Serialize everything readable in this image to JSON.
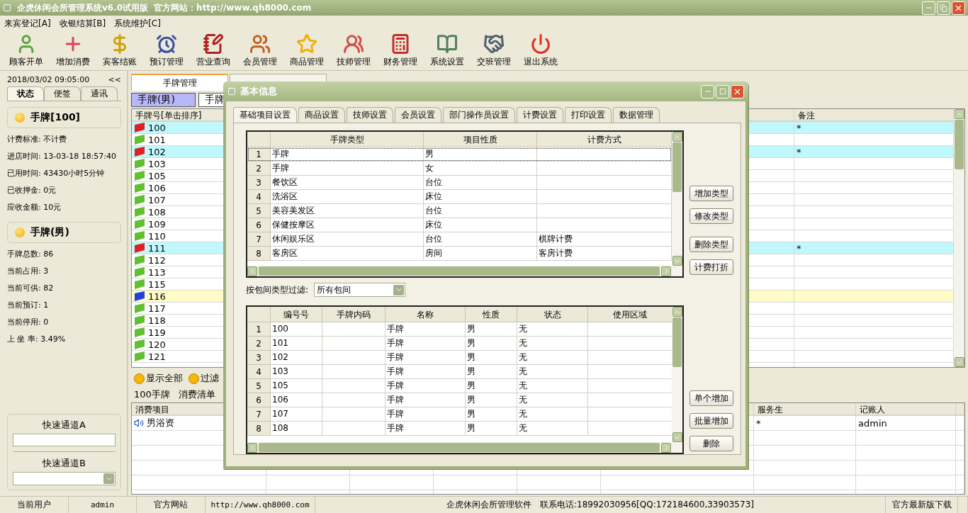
{
  "window": {
    "title": "企虎休闲会所管理系统v6.0试用版",
    "site": "官方网站：http://www.qh8000.com"
  },
  "menu": [
    "来宾登记[A]",
    "收银结算[B]",
    "系统维护[C]"
  ],
  "toolbar": [
    "顾客开单",
    "增加消费",
    "宾客结账",
    "预订管理",
    "营业查询",
    "会员管理",
    "商品管理",
    "技师管理",
    "财务管理",
    "系统设置",
    "交班管理",
    "退出系统"
  ],
  "left_panel": {
    "datetime": "2018/03/02 09:05:00",
    "collapse": "<<",
    "tabs": [
      {
        "label": "状态",
        "selected": true
      },
      {
        "label": "便签",
        "selected": false
      },
      {
        "label": "通讯",
        "selected": false
      }
    ],
    "card": {
      "title": "手牌[100]",
      "lines": [
        "计费标准: 不计费",
        "进店时间: 13-03-18 18:57:40",
        "已用时间: 43430小时5分钟",
        "已收押金: 0元",
        "应收金额: 10元"
      ]
    },
    "group": {
      "title": "手牌(男)",
      "lines": [
        "手牌总数: 86",
        "当前占用: 3",
        "当前可供: 82",
        "当前预订: 1",
        "当前停用: 0",
        "上 坐 率: 3.49%"
      ]
    },
    "quick_a": {
      "label": "快速通道A"
    },
    "quick_b": {
      "label": "快速通道B"
    }
  },
  "main_tabs": [
    {
      "label": "手牌管理",
      "selected": true
    },
    {
      "selected": false
    }
  ],
  "sub_tabs": [
    {
      "label": "手牌(男)",
      "selected": true
    },
    {
      "label": "手牌",
      "selected": false
    }
  ],
  "tags": {
    "columns": {
      "number": "手牌号[单击排序]",
      "note": "备注"
    },
    "rows": [
      {
        "number": "100",
        "kind": "occupied",
        "color": "#e02020",
        "note": "*"
      },
      {
        "number": "101",
        "kind": "free",
        "color": "#60c030"
      },
      {
        "number": "102",
        "kind": "occupied",
        "color": "#e02020",
        "note": "*"
      },
      {
        "number": "103",
        "kind": "free",
        "color": "#60c030"
      },
      {
        "number": "105",
        "kind": "free",
        "color": "#60c030"
      },
      {
        "number": "106",
        "kind": "free",
        "color": "#60c030"
      },
      {
        "number": "107",
        "kind": "free",
        "color": "#60c030"
      },
      {
        "number": "108",
        "kind": "free",
        "color": "#60c030"
      },
      {
        "number": "109",
        "kind": "free",
        "color": "#60c030"
      },
      {
        "number": "110",
        "kind": "free",
        "color": "#60c030"
      },
      {
        "number": "111",
        "kind": "occupied",
        "color": "#e02020",
        "note": "*"
      },
      {
        "number": "112",
        "kind": "free",
        "color": "#60c030"
      },
      {
        "number": "113",
        "kind": "free",
        "color": "#60c030"
      },
      {
        "number": "115",
        "kind": "free",
        "color": "#60c030"
      },
      {
        "number": "116",
        "kind": "reserved",
        "color": "#2040e0"
      },
      {
        "number": "117",
        "kind": "free",
        "color": "#60c030"
      },
      {
        "number": "118",
        "kind": "free",
        "color": "#60c030"
      },
      {
        "number": "119",
        "kind": "free",
        "color": "#60c030"
      },
      {
        "number": "120",
        "kind": "free",
        "color": "#60c030"
      },
      {
        "number": "121",
        "kind": "free",
        "color": "#60c030"
      }
    ]
  },
  "filter_buttons": [
    "显示全部",
    "过滤"
  ],
  "bill_info": [
    "100手牌",
    "消费清单"
  ],
  "consumption": {
    "columns": {
      "item": "消费项目",
      "waiter": "服务生",
      "recorder": "记账人"
    },
    "rows": [
      {
        "item": "男浴资",
        "waiter": "*",
        "recorder": "admin"
      }
    ]
  },
  "dialog": {
    "title": "基本信息",
    "tabs": [
      {
        "label": "基础项目设置",
        "selected": true
      },
      {
        "label": "商品设置",
        "selected": false
      },
      {
        "label": "技师设置",
        "selected": false
      },
      {
        "label": "会员设置",
        "selected": false
      },
      {
        "label": "部门操作员设置",
        "selected": false
      },
      {
        "label": "计费设置",
        "selected": false
      },
      {
        "label": "打印设置",
        "selected": false
      },
      {
        "label": "数据管理",
        "selected": false
      }
    ],
    "types": {
      "columns": [
        "手牌类型",
        "项目性质",
        "计费方式"
      ],
      "rows": [
        {
          "no": "1",
          "cells": [
            "手牌",
            "男"
          ],
          "selected": true
        },
        {
          "no": "2",
          "cells": [
            "手牌",
            "女"
          ],
          "selected": false
        },
        {
          "no": "3",
          "cells": [
            "餐饮区",
            "台位"
          ],
          "selected": false
        },
        {
          "no": "4",
          "cells": [
            "洗浴区",
            "床位"
          ],
          "selected": false
        },
        {
          "no": "5",
          "cells": [
            "美容美发区",
            "台位"
          ],
          "selected": false
        },
        {
          "no": "6",
          "cells": [
            "保健按摩区",
            "床位"
          ],
          "selected": false
        },
        {
          "no": "7",
          "cells": [
            "休闲娱乐区",
            "台位",
            "棋牌计费"
          ],
          "selected": false
        },
        {
          "no": "8",
          "cells": [
            "客房区",
            "房间",
            "客房计费"
          ],
          "selected": false
        }
      ]
    },
    "type_buttons": [
      "增加类型",
      "修改类型",
      "删除类型",
      "计费打折"
    ],
    "filter": {
      "label": "按包间类型过滤:",
      "value": "所有包间"
    },
    "items": {
      "columns": [
        "编号号",
        "手牌内码",
        "名称",
        "性质",
        "状态",
        "使用区域"
      ],
      "rows": [
        {
          "no": "1",
          "number": "100",
          "name": "手牌",
          "nature": "男",
          "state": "无"
        },
        {
          "no": "2",
          "number": "101",
          "name": "手牌",
          "nature": "男",
          "state": "无"
        },
        {
          "no": "3",
          "number": "102",
          "name": "手牌",
          "nature": "男",
          "state": "无"
        },
        {
          "no": "4",
          "number": "103",
          "name": "手牌",
          "nature": "男",
          "state": "无"
        },
        {
          "no": "5",
          "number": "105",
          "name": "手牌",
          "nature": "男",
          "state": "无"
        },
        {
          "no": "6",
          "number": "106",
          "name": "手牌",
          "nature": "男",
          "state": "无"
        },
        {
          "no": "7",
          "number": "107",
          "name": "手牌",
          "nature": "男",
          "state": "无"
        },
        {
          "no": "8",
          "number": "108",
          "name": "手牌",
          "nature": "男",
          "state": "无"
        }
      ]
    },
    "item_buttons": [
      "单个增加",
      "批量增加",
      "删除"
    ]
  },
  "status_bar": {
    "user_label": "当前用户",
    "user": "admin",
    "site_label": "官方网站",
    "site": "http://www.qh8000.com",
    "product": "企虎休闲会所管理软件",
    "contact": "联系电话:18992030956[QQ:172184600,33903573]",
    "download": "官方最新版下载"
  }
}
